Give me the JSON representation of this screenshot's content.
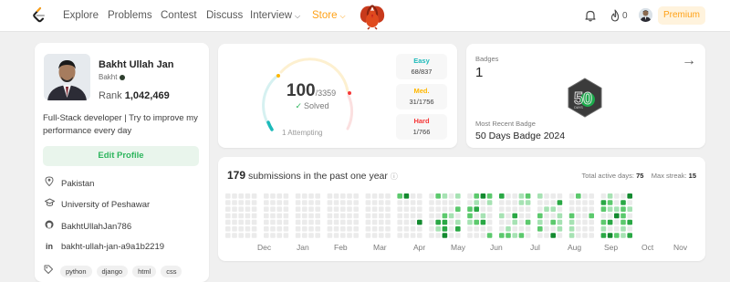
{
  "nav": {
    "items": [
      {
        "label": "Explore"
      },
      {
        "label": "Problems"
      },
      {
        "label": "Contest"
      },
      {
        "label": "Discuss"
      },
      {
        "label": "Interview"
      },
      {
        "label": "Store"
      }
    ],
    "streak_count": "0",
    "premium_label": "Premium",
    "accent_color": "#ffa116",
    "icons": [
      "logo-icon",
      "turkey-icon",
      "bell-icon",
      "streak-icon",
      "avatar"
    ]
  },
  "profile": {
    "name": "Bakht Ullah Jan",
    "username": "Bakht",
    "rank_label": "Rank",
    "rank_value": "1,042,469",
    "bio": "Full-Stack developer | Try to improve my performance every day",
    "edit_label": "Edit Profile",
    "location": "Pakistan",
    "school": "University of Peshawar",
    "github": "BakhtUllahJan786",
    "linkedin": "bakht-ullah-jan-a9a1b2219",
    "tags": [
      "python",
      "django",
      "html",
      "css"
    ]
  },
  "solved": {
    "count": "100",
    "total": "/3359",
    "label": "Solved",
    "attempting": "1 Attempting",
    "fraction": 0.0298,
    "difficulty": [
      {
        "label": "Easy",
        "value": "68/837",
        "color": "#1cbaba"
      },
      {
        "label": "Med.",
        "value": "31/1756",
        "color": "#ffb700"
      },
      {
        "label": "Hard",
        "value": "1/766",
        "color": "#f63737"
      }
    ]
  },
  "badges": {
    "title": "Badges",
    "count": "1",
    "recent_label": "Most Recent Badge",
    "recent_name": "50 Days Badge 2024",
    "badge_glyph": "50",
    "badge_caption": "DAYS"
  },
  "submissions": {
    "count": "179",
    "text": "submissions in the past one year",
    "active_label": "Total active days:",
    "active_value": "75",
    "streak_label": "Max streak:",
    "streak_value": "15",
    "months": [
      "Dec",
      "Jan",
      "Feb",
      "Mar",
      "Apr",
      "May",
      "Jun",
      "Jul",
      "Aug",
      "Sep",
      "Oct",
      "Nov"
    ],
    "colors": {
      "empty": "#ebebeb",
      "l1": "#a6e2b3",
      "l2": "#5cc96d",
      "l3": "#2aa845",
      "l4": "#138a2f"
    }
  }
}
